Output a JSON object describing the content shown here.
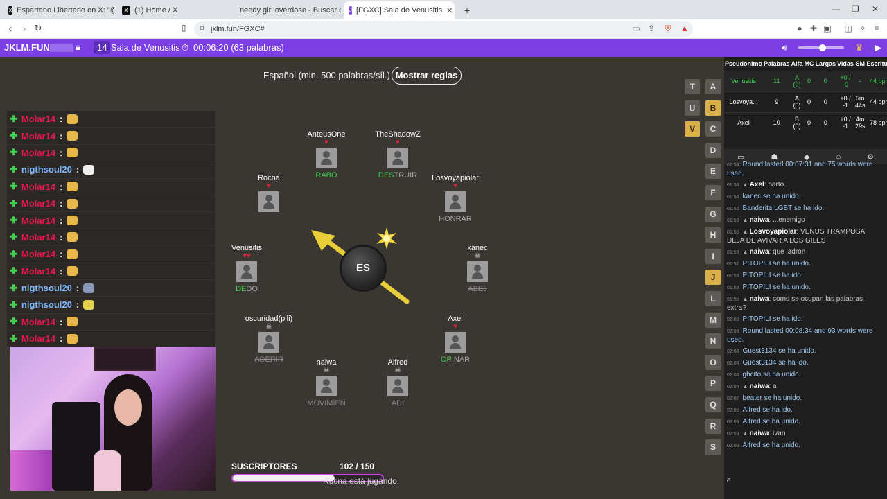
{
  "browser": {
    "tabs": [
      {
        "label": "Espartano Libertario on X: \"@ladere...",
        "icon": "x-logo-icon"
      },
      {
        "label": "(1) Home / X",
        "icon": "x-logo-icon"
      },
      {
        "label": "needy girl overdose - Buscar con Goo...",
        "icon": "google-icon"
      },
      {
        "label": "[FGXC] Sala de Venusitis",
        "icon": "jklm-icon",
        "active": true
      }
    ],
    "url": "jklm.fun/FGXC#"
  },
  "game_header": {
    "site": "JKLM.FUN/",
    "players_count": "14",
    "room_name": "Sala de Venusitis",
    "timer": "00:06:20 (63 palabras)"
  },
  "rules": {
    "language_text": "Español (min. 500 palabras/síl.)",
    "button_label": "Mostrar reglas"
  },
  "bomb": {
    "syllable": "ES"
  },
  "players": [
    {
      "name": "AnteusOne",
      "hearts": "♥",
      "word": "RABO",
      "word_style": "green"
    },
    {
      "name": "TheShadowZ",
      "hearts": "♥",
      "word_prefix": "DES",
      "word_suffix": "TRUIR",
      "word_style": "mixed"
    },
    {
      "name": "Rocna",
      "hearts": "♥",
      "word": "",
      "word_style": "green"
    },
    {
      "name": "Losvoyapiolar",
      "hearts": "♥",
      "word": "HONRAR",
      "word_style": "grey"
    },
    {
      "name": "Venusitis",
      "hearts": "♥♥",
      "word_prefix": "DE",
      "word_suffix": "DO",
      "word_style": "mixed"
    },
    {
      "name": "kanec",
      "dead": true,
      "word": "ABEJ",
      "word_style": "strike"
    },
    {
      "name": "oscuridad(pili)",
      "dead": true,
      "word": "ADERIR",
      "word_style": "strike"
    },
    {
      "name": "Axel",
      "hearts": "♥",
      "word_prefix": "OP",
      "word_suffix": "INAR",
      "word_style": "mixed"
    },
    {
      "name": "naiwa",
      "dead": true,
      "word": "MOVIMIEN",
      "word_style": "strike"
    },
    {
      "name": "Alfred",
      "dead": true,
      "word": "ADI",
      "word_style": "strike"
    }
  ],
  "letters_col1": [
    "T",
    "U",
    "V"
  ],
  "letters_col2": [
    "A",
    "B",
    "C",
    "D",
    "E",
    "F",
    "G",
    "H",
    "I",
    "J",
    "L",
    "M",
    "N",
    "O",
    "P",
    "Q",
    "R",
    "S"
  ],
  "used_letters": [
    "B",
    "V",
    "J"
  ],
  "subscribers": {
    "label": "SUSCRIPTORES",
    "count": "102 / 150",
    "progress": 0.68
  },
  "turn_text": "Rocna está jugando.",
  "left_chat": [
    {
      "user": "Molar14",
      "color": "#e8174f",
      "emote": "#e8b94a"
    },
    {
      "user": "Molar14",
      "color": "#e8174f",
      "emote": "#e8b94a"
    },
    {
      "user": "Molar14",
      "color": "#e8174f",
      "emote": "#e8b94a"
    },
    {
      "user": "nigthsoul20",
      "color": "#7fb8ff",
      "emote": "#eeeeee"
    },
    {
      "user": "Molar14",
      "color": "#e8174f",
      "emote": "#e8b94a"
    },
    {
      "user": "Molar14",
      "color": "#e8174f",
      "emote": "#e8b94a"
    },
    {
      "user": "Molar14",
      "color": "#e8174f",
      "emote": "#e8b94a"
    },
    {
      "user": "Molar14",
      "color": "#e8174f",
      "emote": "#e8b94a"
    },
    {
      "user": "Molar14",
      "color": "#e8174f",
      "emote": "#e8b94a"
    },
    {
      "user": "Molar14",
      "color": "#e8174f",
      "emote": "#e8b94a"
    },
    {
      "user": "nigthsoul20",
      "color": "#7fb8ff",
      "emote": "#8899bb"
    },
    {
      "user": "nigthsoul20",
      "color": "#7fb8ff",
      "emote": "#e0d24a"
    },
    {
      "user": "Molar14",
      "color": "#e8174f",
      "emote": "#e8b94a"
    },
    {
      "user": "Molar14",
      "color": "#e8174f",
      "emote": "#e8b94a"
    }
  ],
  "score_table": {
    "headers": [
      "Pseudónimo",
      "Palabras",
      "Alfa",
      "MC",
      "Largas",
      "Vidas",
      "SM",
      "Escritura"
    ],
    "rows": [
      {
        "name": "Venusitis",
        "words": "11",
        "alfa": "A (0)",
        "mc": "0",
        "largas": "0",
        "vidas": "+0 / -0",
        "sm": "-",
        "esc": "44 ppm",
        "me": true
      },
      {
        "name": "Losvoya...",
        "words": "9",
        "alfa": "A (0)",
        "mc": "0",
        "largas": "0",
        "vidas": "+0 / -1",
        "sm": "5m 44s",
        "esc": "44 ppm"
      },
      {
        "name": "Axel",
        "words": "10",
        "alfa": "B (0)",
        "mc": "0",
        "largas": "0",
        "vidas": "+0 / -1",
        "sm": "4m 29s",
        "esc": "78 ppm"
      }
    ]
  },
  "chat_log": [
    {
      "t": "01:54",
      "text": "Round lasted 00:07:31 and 75 words were used.",
      "kind": "sys"
    },
    {
      "t": "01:54",
      "user": "Axel",
      "text": "parto",
      "kind": "msg"
    },
    {
      "t": "01:54",
      "text": "kanec se ha unido.",
      "kind": "sys"
    },
    {
      "t": "01:55",
      "text": "Banderita LGBT se ha ido.",
      "kind": "sys"
    },
    {
      "t": "01:56",
      "user": "naiwa",
      "text": "...enemigo",
      "kind": "msg"
    },
    {
      "t": "01:56",
      "user": "Losvoyapiolar",
      "text": "VENUS TRAMPOSA DEJA DE AVIVAR A LOS GILES",
      "kind": "msg"
    },
    {
      "t": "01:56",
      "user": "naiwa",
      "text": "que ladron",
      "kind": "msg"
    },
    {
      "t": "01:57",
      "text": "PITOPILI se ha unido.",
      "kind": "sys"
    },
    {
      "t": "01:58",
      "text": "PITOPILI se ha ido.",
      "kind": "sys"
    },
    {
      "t": "01:58",
      "text": "PITOPILI se ha unido.",
      "kind": "sys"
    },
    {
      "t": "01:59",
      "user": "naiwa",
      "text": "como se ocupan las palabras extra?",
      "kind": "msg"
    },
    {
      "t": "02:00",
      "text": "PITOPILI se ha ido.",
      "kind": "sys"
    },
    {
      "t": "02:03",
      "text": "Round lasted 00:08:34 and 93 words were used.",
      "kind": "sys"
    },
    {
      "t": "02:03",
      "text": "Guest3134 se ha unido.",
      "kind": "sys"
    },
    {
      "t": "02:04",
      "text": "Guest3134 se ha ido.",
      "kind": "sys"
    },
    {
      "t": "02:04",
      "text": "gbcito se ha unido.",
      "kind": "sys"
    },
    {
      "t": "02:04",
      "user": "naiwa",
      "text": "a",
      "kind": "msg"
    },
    {
      "t": "02:07",
      "text": "beater se ha unido.",
      "kind": "sys"
    },
    {
      "t": "02:09",
      "text": "Alfred  se ha ido.",
      "kind": "sys"
    },
    {
      "t": "02:09",
      "text": "Alfred  se ha unido.",
      "kind": "sys"
    },
    {
      "t": "02:09",
      "user": "naiwa",
      "text": "ivan",
      "kind": "msg"
    },
    {
      "t": "02:09",
      "text": "Alfred se ha unido.",
      "kind": "sys"
    }
  ],
  "chat_input_value": "e"
}
